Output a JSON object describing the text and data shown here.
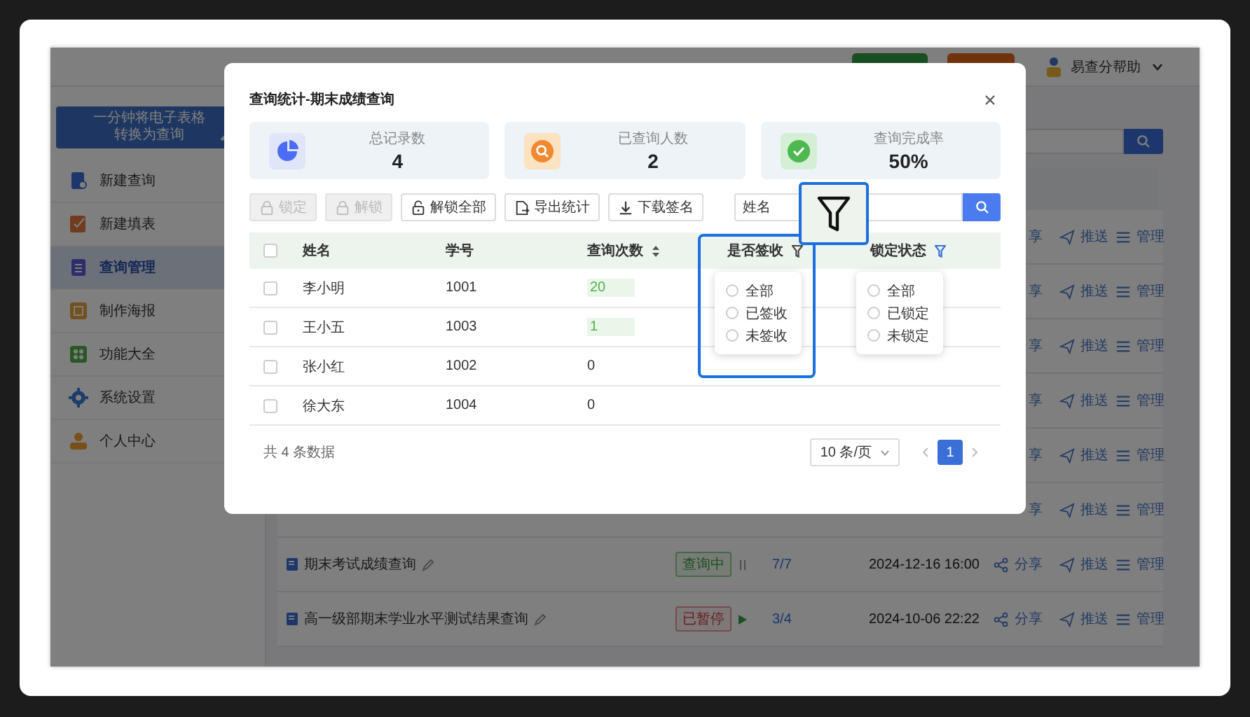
{
  "app": {
    "header": {
      "help_label": "易查分帮助"
    },
    "sidebar": {
      "banner_lines": [
        "一分钟将电子表格",
        "转换为查询"
      ],
      "items": [
        {
          "label": "新建查询",
          "selected": false
        },
        {
          "label": "新建填表",
          "selected": false
        },
        {
          "label": "查询管理",
          "selected": true
        },
        {
          "label": "制作海报",
          "selected": false
        },
        {
          "label": "功能大全",
          "selected": false
        },
        {
          "label": "系统设置",
          "selected": false
        },
        {
          "label": "个人中心",
          "selected": false
        }
      ]
    },
    "rows": [
      {
        "actions": [
          "享",
          "推送",
          "管理"
        ]
      },
      {
        "actions": [
          "享",
          "推送",
          "管理"
        ]
      },
      {
        "actions": [
          "享",
          "推送",
          "管理"
        ]
      },
      {
        "actions": [
          "享",
          "推送",
          "管理"
        ]
      },
      {
        "actions": [
          "享",
          "推送",
          "管理"
        ]
      },
      {
        "actions": [
          "享",
          "推送",
          "管理"
        ]
      },
      {
        "title": "期末考试成绩查询",
        "status": "查询中",
        "kind": "running",
        "progress": "7/7",
        "date": "2024-12-16 16:00",
        "actions": [
          "分享",
          "推送",
          "管理"
        ]
      },
      {
        "title": "高一级部期末学业水平测试结果查询",
        "status": "已暂停",
        "kind": "paused",
        "progress": "3/4",
        "date": "2024-10-06 22:22",
        "actions": [
          "分享",
          "推送",
          "管理"
        ]
      }
    ]
  },
  "modal": {
    "title": "查询统计-期末成绩查询",
    "stats": [
      {
        "label": "总记录数",
        "value": "4"
      },
      {
        "label": "已查询人数",
        "value": "2"
      },
      {
        "label": "查询完成率",
        "value": "50%"
      }
    ],
    "toolbar": [
      {
        "label": "锁定",
        "disabled": true
      },
      {
        "label": "解锁",
        "disabled": true
      },
      {
        "label": "解锁全部",
        "disabled": false
      },
      {
        "label": "导出统计",
        "disabled": false
      },
      {
        "label": "下载签名",
        "disabled": false
      }
    ],
    "search": {
      "value": "姓名"
    },
    "table": {
      "select_all_checked": false,
      "columns": [
        {
          "label": "姓名",
          "kind": "plain"
        },
        {
          "label": "学号",
          "kind": "plain"
        },
        {
          "label": "查询次数",
          "kind": "sort"
        },
        {
          "label": "是否签收",
          "kind": "filter",
          "filter_active": false,
          "open": true,
          "options": [
            {
              "label": "全部",
              "selected": false
            },
            {
              "label": "已签收",
              "selected": false
            },
            {
              "label": "未签收",
              "selected": false
            }
          ]
        },
        {
          "label": "锁定状态",
          "kind": "filter",
          "filter_active": true,
          "open": true,
          "options": [
            {
              "label": "全部",
              "selected": false
            },
            {
              "label": "已锁定",
              "selected": false
            },
            {
              "label": "未锁定",
              "selected": false
            }
          ]
        }
      ],
      "rows": [
        {
          "checked": false,
          "name": "李小明",
          "id": "1001",
          "count": "20",
          "count_tag": true
        },
        {
          "checked": false,
          "name": "王小五",
          "id": "1003",
          "count": "1",
          "count_tag": true
        },
        {
          "checked": false,
          "name": "张小红",
          "id": "1002",
          "count": "0",
          "count_tag": false
        },
        {
          "checked": false,
          "name": "徐大东",
          "id": "1004",
          "count": "0",
          "count_tag": false
        }
      ]
    },
    "footer": {
      "total": "共 4 条数据",
      "page_size": "10 条/页",
      "pages": [
        {
          "label": "1",
          "selected": true
        }
      ]
    }
  }
}
